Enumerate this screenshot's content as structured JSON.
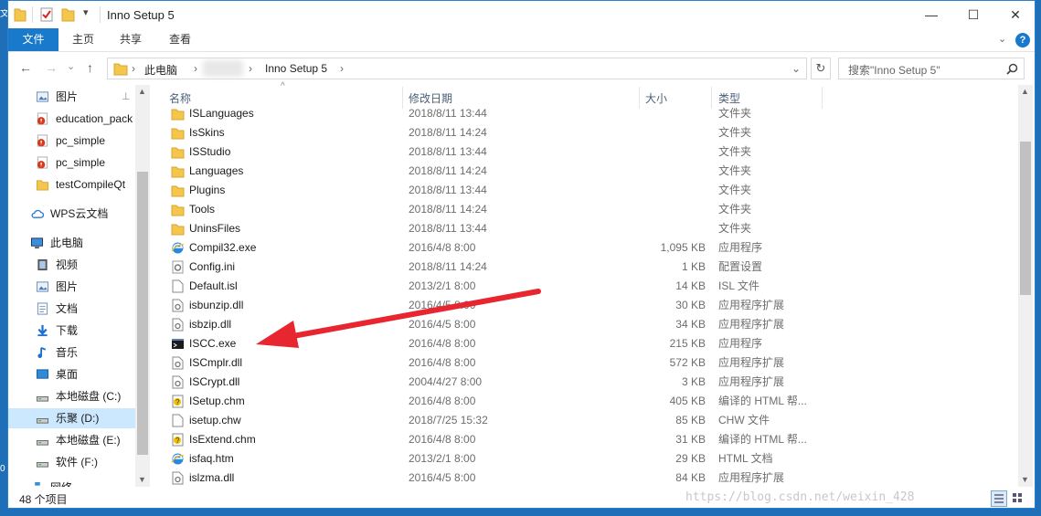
{
  "left_strip": {
    "top": "文",
    "mid": "0"
  },
  "window": {
    "title": "Inno Setup 5",
    "min": "—",
    "max": "☐",
    "close": "✕"
  },
  "ribbon": {
    "tabs": [
      "文件",
      "主页",
      "共享",
      "查看"
    ],
    "help": "?"
  },
  "address": {
    "back": "←",
    "forward": "→",
    "history": "⌄",
    "up": "↑",
    "crumbs": [
      "此电脑",
      "Inno Setup 5"
    ],
    "sep": "›",
    "dropdown": "⌄",
    "refresh": "↻"
  },
  "search": {
    "placeholder": "搜索\"Inno Setup 5\"",
    "icon": "search-icon"
  },
  "nav": {
    "items": [
      {
        "label": "图片",
        "icon": "pictures-icon",
        "pin": true
      },
      {
        "label": "education_pack",
        "icon": "warning-doc-icon"
      },
      {
        "label": "pc_simple",
        "icon": "warning-doc-icon"
      },
      {
        "label": "pc_simple",
        "icon": "warning-doc-icon"
      },
      {
        "label": "testCompileQt",
        "icon": "folder-icon"
      },
      {
        "label": "WPS云文档",
        "icon": "cloud-icon"
      },
      {
        "label": "此电脑",
        "icon": "computer-icon"
      },
      {
        "label": "视频",
        "icon": "video-icon"
      },
      {
        "label": "图片",
        "icon": "pictures-icon"
      },
      {
        "label": "文档",
        "icon": "documents-icon"
      },
      {
        "label": "下载",
        "icon": "download-icon"
      },
      {
        "label": "音乐",
        "icon": "music-icon"
      },
      {
        "label": "桌面",
        "icon": "desktop-icon"
      },
      {
        "label": "本地磁盘 (C:)",
        "icon": "drive-icon"
      },
      {
        "label": "乐聚 (D:)",
        "icon": "drive-icon",
        "selected": true
      },
      {
        "label": "本地磁盘 (E:)",
        "icon": "drive-icon"
      },
      {
        "label": "软件 (F:)",
        "icon": "drive-icon"
      },
      {
        "label": "网络",
        "icon": "network-icon"
      }
    ]
  },
  "columns": {
    "name": "名称",
    "date": "修改日期",
    "size": "大小",
    "type": "类型",
    "sort_glyph": "^"
  },
  "files": [
    {
      "name": "ISLanguages",
      "date": "2018/8/11 13:44",
      "size": "",
      "type": "文件夹",
      "icon": "folder-icon"
    },
    {
      "name": "IsSkins",
      "date": "2018/8/11 14:24",
      "size": "",
      "type": "文件夹",
      "icon": "folder-icon"
    },
    {
      "name": "ISStudio",
      "date": "2018/8/11 13:44",
      "size": "",
      "type": "文件夹",
      "icon": "folder-icon"
    },
    {
      "name": "Languages",
      "date": "2018/8/11 14:24",
      "size": "",
      "type": "文件夹",
      "icon": "folder-icon"
    },
    {
      "name": "Plugins",
      "date": "2018/8/11 13:44",
      "size": "",
      "type": "文件夹",
      "icon": "folder-icon"
    },
    {
      "name": "Tools",
      "date": "2018/8/11 14:24",
      "size": "",
      "type": "文件夹",
      "icon": "folder-icon"
    },
    {
      "name": "UninsFiles",
      "date": "2018/8/11 13:44",
      "size": "",
      "type": "文件夹",
      "icon": "folder-icon"
    },
    {
      "name": "Compil32.exe",
      "date": "2016/4/8 8:00",
      "size": "1,095 KB",
      "type": "应用程序",
      "icon": "ie-app-icon"
    },
    {
      "name": "Config.ini",
      "date": "2018/8/11 14:24",
      "size": "1 KB",
      "type": "配置设置",
      "icon": "config-file-icon"
    },
    {
      "name": "Default.isl",
      "date": "2013/2/1 8:00",
      "size": "14 KB",
      "type": "ISL 文件",
      "icon": "file-icon"
    },
    {
      "name": "isbunzip.dll",
      "date": "2016/4/5 8:00",
      "size": "30 KB",
      "type": "应用程序扩展",
      "icon": "dll-icon"
    },
    {
      "name": "isbzip.dll",
      "date": "2016/4/5 8:00",
      "size": "34 KB",
      "type": "应用程序扩展",
      "icon": "dll-icon"
    },
    {
      "name": "ISCC.exe",
      "date": "2016/4/8 8:00",
      "size": "215 KB",
      "type": "应用程序",
      "icon": "console-app-icon"
    },
    {
      "name": "ISCmplr.dll",
      "date": "2016/4/8 8:00",
      "size": "572 KB",
      "type": "应用程序扩展",
      "icon": "dll-icon"
    },
    {
      "name": "ISCrypt.dll",
      "date": "2004/4/27 8:00",
      "size": "3 KB",
      "type": "应用程序扩展",
      "icon": "dll-icon"
    },
    {
      "name": "ISetup.chm",
      "date": "2016/4/8 8:00",
      "size": "405 KB",
      "type": "编译的 HTML 帮...",
      "icon": "help-file-icon"
    },
    {
      "name": "isetup.chw",
      "date": "2018/7/25 15:32",
      "size": "85 KB",
      "type": "CHW 文件",
      "icon": "file-icon"
    },
    {
      "name": "IsExtend.chm",
      "date": "2016/4/8 8:00",
      "size": "31 KB",
      "type": "编译的 HTML 帮...",
      "icon": "help-file-icon"
    },
    {
      "name": "isfaq.htm",
      "date": "2013/2/1 8:00",
      "size": "29 KB",
      "type": "HTML 文档",
      "icon": "ie-app-icon"
    },
    {
      "name": "islzma.dll",
      "date": "2016/4/5 8:00",
      "size": "84 KB",
      "type": "应用程序扩展",
      "icon": "dll-icon"
    }
  ],
  "status": {
    "count": "48 个项目"
  },
  "watermark": "https://blog.csdn.net/weixin_428",
  "colors": {
    "accent": "#1979ca",
    "arrow": "#e8262f",
    "folder": "#f4c64b"
  }
}
